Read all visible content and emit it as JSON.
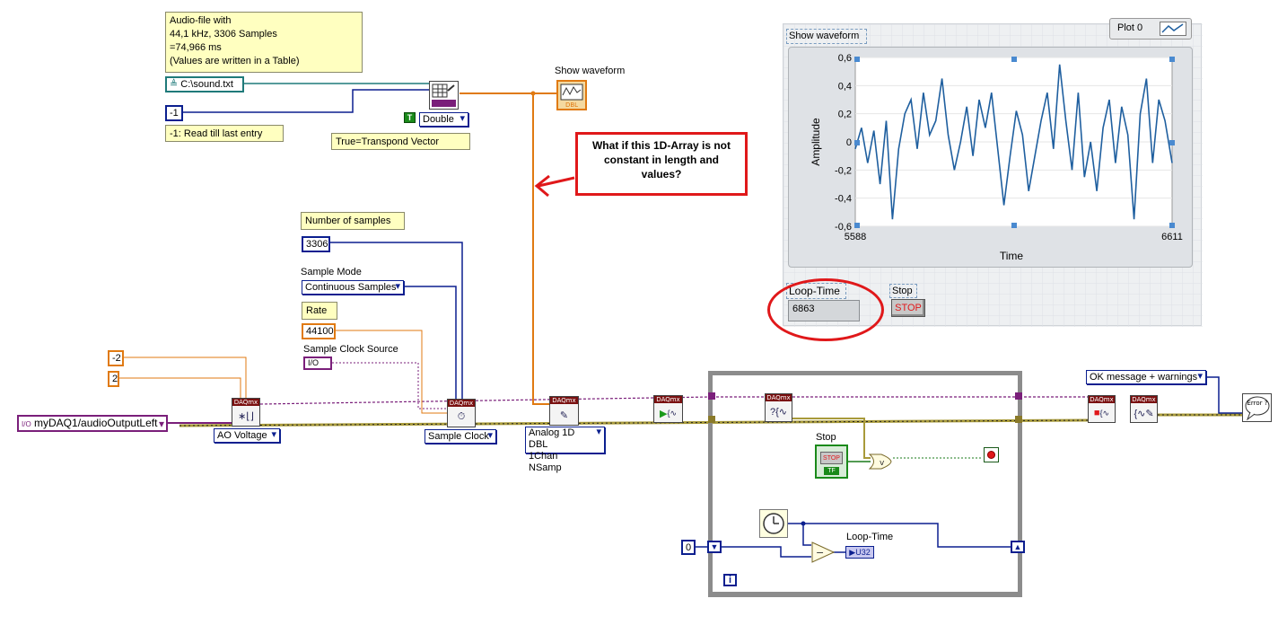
{
  "notes": {
    "audio_info": "Audio-file with\n44,1 kHz, 3306 Samples\n=74,966 ms\n(Values are written in a Table)",
    "read_hint": "-1: Read till last entry",
    "transpose_hint": "True=Transpond Vector",
    "question": "What if this 1D-Array is not constant in length and values?"
  },
  "file_path": {
    "value": "C:\\sound.txt"
  },
  "read_count": {
    "value": "-1"
  },
  "datatype_ring": {
    "value": "Double",
    "bool_const": "T"
  },
  "show_waveform_label": "Show waveform",
  "num_samples": {
    "label": "Number of samples",
    "value": "3306"
  },
  "sample_mode": {
    "label": "Sample Mode",
    "value": "Continuous Samples"
  },
  "rate": {
    "label": "Rate",
    "value": "44100"
  },
  "clock_source": {
    "label": "Sample Clock Source",
    "value": "I/O"
  },
  "min_value": "-2",
  "max_value": "2",
  "channel": {
    "value": "myDAQ1/audioOutputLeft"
  },
  "ao_voltage": "AO Voltage",
  "sample_clock": "Sample Clock",
  "write_mode": "Analog 1D DBL\n1Chan NSamp",
  "error_mode": "OK message + warnings",
  "loop": {
    "stop_label": "Stop",
    "stop_text": "STOP",
    "tf": "TF",
    "loop_time_label": "Loop-Time",
    "u32": "U32",
    "init_value": "0",
    "iteration": "i"
  },
  "front_panel": {
    "plot_legend": "Plot 0",
    "chart_label": "Show waveform",
    "loop_time_label": "Loop-Time",
    "loop_time_value": "6863",
    "stop_label": "Stop",
    "stop_text": "STOP"
  },
  "icons": {
    "daqmx_header": "DAQmx",
    "error_text": "Error ?"
  },
  "colors": {
    "wire_orange": "#e07a12",
    "wire_blue": "#0b1f8f",
    "wire_purple": "#7a1f7a",
    "wire_error": "#a89a3a",
    "annotation_red": "#e0181a",
    "plot_line": "#1f5f9f"
  },
  "chart_data": {
    "type": "line",
    "title": "",
    "xlabel": "Time",
    "ylabel": "Amplitude",
    "xlim": [
      5588,
      6611
    ],
    "ylim": [
      -0.6,
      0.6
    ],
    "x_ticks": [
      "5588",
      "6611"
    ],
    "y_ticks": [
      "0,6",
      "0,4",
      "0,2",
      "0",
      "-0,2",
      "-0,4",
      "-0,6"
    ],
    "x": [
      5588,
      5608,
      5628,
      5648,
      5668,
      5688,
      5708,
      5728,
      5748,
      5768,
      5788,
      5808,
      5828,
      5848,
      5868,
      5888,
      5908,
      5928,
      5948,
      5968,
      5988,
      6008,
      6028,
      6048,
      6068,
      6088,
      6108,
      6128,
      6148,
      6168,
      6188,
      6208,
      6228,
      6248,
      6268,
      6288,
      6308,
      6328,
      6348,
      6368,
      6388,
      6408,
      6428,
      6448,
      6468,
      6488,
      6508,
      6528,
      6548,
      6568,
      6588,
      6611
    ],
    "values": [
      -0.05,
      0.1,
      -0.15,
      0.08,
      -0.3,
      0.15,
      -0.55,
      -0.05,
      0.2,
      0.3,
      -0.05,
      0.35,
      0.05,
      0.15,
      0.45,
      0.05,
      -0.2,
      0.0,
      0.25,
      -0.1,
      0.3,
      0.1,
      0.35,
      -0.05,
      -0.45,
      -0.1,
      0.22,
      0.05,
      -0.35,
      -0.1,
      0.15,
      0.35,
      -0.05,
      0.55,
      0.15,
      -0.2,
      0.35,
      -0.25,
      0.0,
      -0.35,
      0.1,
      0.3,
      -0.15,
      0.25,
      0.05,
      -0.55,
      0.2,
      0.45,
      -0.15,
      0.3,
      0.15,
      -0.15
    ]
  }
}
